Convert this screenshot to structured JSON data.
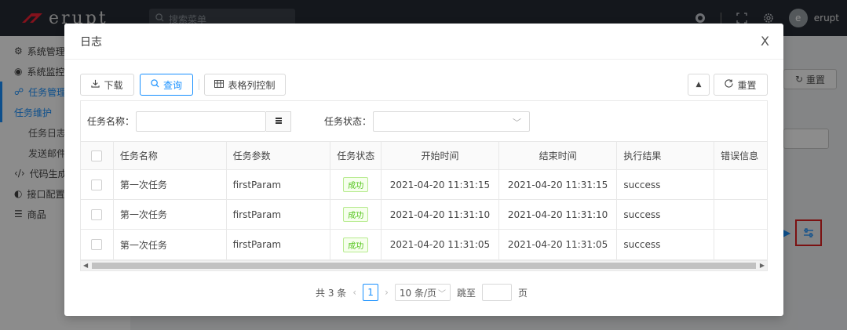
{
  "app": {
    "logo_text": "erupt",
    "search_placeholder": "搜索菜单",
    "user_initial": "e",
    "user_name": "erupt",
    "sidebar": [
      {
        "label": "系统管理",
        "icon": "gears-icon",
        "level": 1,
        "active": false
      },
      {
        "label": "系统监控",
        "icon": "monitor-icon",
        "level": 1,
        "active": false
      },
      {
        "label": "任务管理",
        "icon": "cluster-icon",
        "level": 1,
        "active": true
      },
      {
        "label": "任务维护",
        "level": 2,
        "active": true
      },
      {
        "label": "任务日志",
        "level": 2,
        "active": false
      },
      {
        "label": "发送邮件",
        "level": 2,
        "active": false
      },
      {
        "label": "代码生成",
        "icon": "code-icon",
        "level": 1,
        "active": false
      },
      {
        "label": "接口配置",
        "icon": "api-icon",
        "level": 1,
        "active": false
      },
      {
        "label": "商品",
        "icon": "list-icon",
        "level": 1,
        "active": false
      }
    ],
    "bg_reset_label": "重置"
  },
  "modal": {
    "title": "日志",
    "close": "X",
    "toolbar": {
      "download_label": "下载",
      "query_label": "查询",
      "columns_label": "表格列控制",
      "reset_label": "重置"
    },
    "filters": {
      "task_name_label": "任务名称：",
      "task_name_value": "",
      "task_status_label": "任务状态：",
      "task_status_value": ""
    },
    "table": {
      "headers": [
        "",
        "任务名称",
        "任务参数",
        "任务状态",
        "开始时间",
        "结束时间",
        "执行结果",
        "错误信息"
      ],
      "rows": [
        {
          "name": "第一次任务",
          "param": "firstParam",
          "status": "成功",
          "start": "2021-04-20 11:31:15",
          "end": "2021-04-20 11:31:15",
          "result": "success",
          "error": ""
        },
        {
          "name": "第一次任务",
          "param": "firstParam",
          "status": "成功",
          "start": "2021-04-20 11:31:10",
          "end": "2021-04-20 11:31:10",
          "result": "success",
          "error": ""
        },
        {
          "name": "第一次任务",
          "param": "firstParam",
          "status": "成功",
          "start": "2021-04-20 11:31:05",
          "end": "2021-04-20 11:31:05",
          "result": "success",
          "error": ""
        }
      ]
    },
    "pagination": {
      "total_text": "共 3 条",
      "current_page": "1",
      "page_size": "10 条/页",
      "jump_label": "跳至",
      "page_suffix": "页"
    }
  },
  "colors": {
    "accent": "#1890ff",
    "success_text": "#52c41a",
    "success_bg": "#f6ffed",
    "highlight_border": "#e02020",
    "topbar": "#262b33"
  }
}
